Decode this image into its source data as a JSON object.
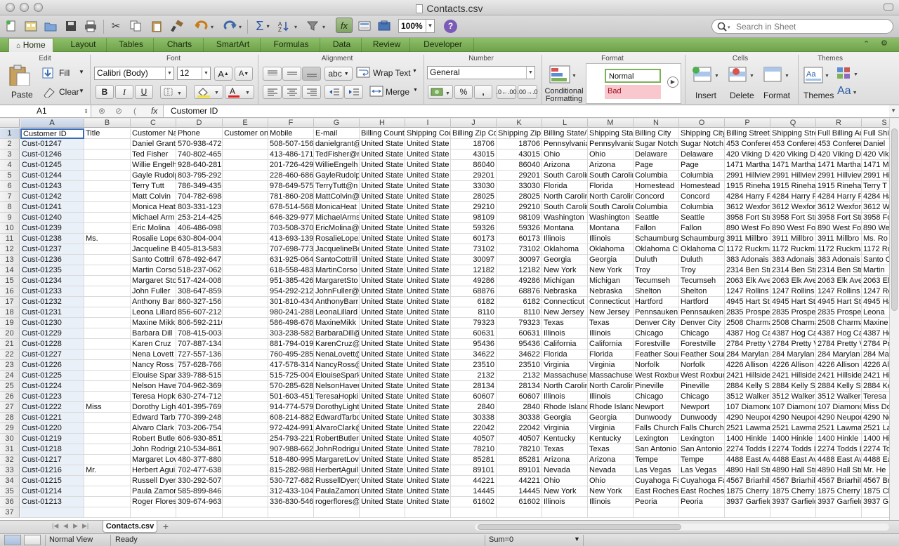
{
  "window": {
    "title": "Contacts.csv"
  },
  "toolbar": {
    "zoom": "100%",
    "help": "?",
    "search_placeholder": "Search in Sheet"
  },
  "ribbon": {
    "tabs": [
      "Home",
      "Layout",
      "Tables",
      "Charts",
      "SmartArt",
      "Formulas",
      "Data",
      "Review",
      "Developer"
    ],
    "active_tab": "Home",
    "groups": {
      "edit": "Edit",
      "font": "Font",
      "alignment": "Alignment",
      "number": "Number",
      "format": "Format",
      "cells": "Cells",
      "themes": "Themes"
    },
    "paste": "Paste",
    "fill": "Fill",
    "clear": "Clear",
    "font_name": "Calibri (Body)",
    "font_size": "12",
    "bold": "B",
    "italic": "I",
    "underline": "U",
    "abc": "abc",
    "wrap_text": "Wrap Text",
    "merge": "Merge",
    "number_format": "General",
    "percent": "%",
    "comma": ",",
    "dec_inc": ".0←.00",
    "dec_dec": ".00→.0",
    "conditional_formatting": "Conditional\nFormatting",
    "style_normal": "Normal",
    "style_bad": "Bad",
    "insert": "Insert",
    "delete": "Delete",
    "format_btn": "Format",
    "themes_btn": "Themes",
    "aa": "Aa"
  },
  "formula_bar": {
    "cell_ref": "A1",
    "fx": "fx",
    "content": "Customer ID"
  },
  "grid": {
    "columns": [
      "A",
      "B",
      "C",
      "D",
      "E",
      "F",
      "G",
      "H",
      "I",
      "J",
      "K",
      "L",
      "M",
      "N",
      "O",
      "P",
      "Q",
      "R",
      "S"
    ],
    "rows": [
      [
        "Customer ID",
        "Title",
        "Customer Na",
        "Phone",
        "Customer on",
        "Mobile",
        "E-mail",
        "Billing Count",
        "Shipping Cou",
        "Billing Zip Co",
        "Shipping Zip",
        "Billing State/",
        "Shipping Stat",
        "Billing City",
        "Shipping City",
        "Billing Street",
        "Shipping Stre",
        "Full Billing Ad",
        "Full Shi"
      ],
      [
        "Cust-01247",
        "",
        "Daniel Grant",
        "570-938-4729",
        "",
        "508-507-156",
        "danielgrant@",
        "United State",
        "United State",
        "18706",
        "18706",
        "Pennsylvania",
        "Pennsylvania",
        "Sugar Notch",
        "Sugar Notch",
        "453 Conferen",
        "453 Conferen",
        "453 Conferen",
        "Daniel"
      ],
      [
        "Cust-01246",
        "",
        "Ted Fisher",
        "740-802-4659",
        "",
        "413-486-171",
        "TedFisher@r",
        "United State",
        "United State",
        "43015",
        "43015",
        "Ohio",
        "Ohio",
        "Delaware",
        "Delaware",
        "420 Viking D",
        "420 Viking D",
        "420 Viking D",
        "420 Vik"
      ],
      [
        "Cust-01245",
        "",
        "Willie Engelh",
        "928-640-2818",
        "",
        "201-726-429",
        "WillieEngelh",
        "United State",
        "United State",
        "86040",
        "86040",
        "Arizona",
        "Arizona",
        "Page",
        "Page",
        "1471 Martha",
        "1471 Martha",
        "1471 Martha",
        "1471 M"
      ],
      [
        "Cust-01244",
        "",
        "Gayle Rudolp",
        "803-795-2925",
        "",
        "228-460-686",
        "GayleRudolp",
        "United State",
        "United State",
        "29201",
        "29201",
        "South Carolin",
        "South Carolin",
        "Columbia",
        "Columbia",
        "2991 Hillview",
        "2991 Hillview",
        "2991 Hillview",
        "2991 Hi"
      ],
      [
        "Cust-01243",
        "",
        "Terry Tutt",
        "786-349-4359",
        "",
        "978-649-575",
        "TerryTutt@n",
        "United State",
        "United State",
        "33030",
        "33030",
        "Florida",
        "Florida",
        "Homestead",
        "Homestead",
        "1915 Rinehar",
        "1915 Rinehar",
        "1915 Rinehar",
        "Terry T"
      ],
      [
        "Cust-01242",
        "",
        "Matt Colvin",
        "704-782-6984",
        "",
        "781-860-208",
        "MattColvin@",
        "United State",
        "United State",
        "28025",
        "28025",
        "North Carolin",
        "North Carolin",
        "Concord",
        "Concord",
        "4284 Harry P",
        "4284 Harry P",
        "4284 Harry P",
        "4284 Ha"
      ],
      [
        "Cust-01241",
        "",
        "Monica Heat",
        "803-331-1239",
        "",
        "678-514-568",
        "MonicaHeat",
        "United State",
        "United State",
        "29210",
        "29210",
        "South Carolin",
        "South Carolin",
        "Columbia",
        "Columbia",
        "3612 Wexfor",
        "3612 Wexfor",
        "3612 Wexfor",
        "3612 W"
      ],
      [
        "Cust-01240",
        "",
        "Michael Arm",
        "253-214-4254",
        "",
        "646-329-977",
        "MichaelArms",
        "United State",
        "United State",
        "98109",
        "98109",
        "Washington",
        "Washington",
        "Seattle",
        "Seattle",
        "3958 Fort Str",
        "3958 Fort Str",
        "3958 Fort Str",
        "3958 Fo"
      ],
      [
        "Cust-01239",
        "",
        "Eric Molina",
        "406-486-0983",
        "",
        "703-508-370",
        "EricMolina@",
        "United State",
        "United State",
        "59326",
        "59326",
        "Montana",
        "Montana",
        "Fallon",
        "Fallon",
        "890 West Fo",
        "890 West Fo",
        "890 West Fo",
        "890 We"
      ],
      [
        "Cust-01238",
        "Ms.",
        "Rosalie Lope",
        "630-804-0049",
        "",
        "413-693-139",
        "RosalieLopez",
        "United State",
        "United State",
        "60173",
        "60173",
        "Illinois",
        "Illinois",
        "Schaumburg",
        "Schaumburg",
        "3911 Millbro",
        "3911 Millbro",
        "3911 Millbro",
        "Ms. Ro"
      ],
      [
        "Cust-01237",
        "",
        "Jacqueline B",
        "405-813-5832",
        "",
        "707-698-773",
        "JacquelineBe",
        "United State",
        "United State",
        "73102",
        "73102",
        "Oklahoma",
        "Oklahoma",
        "Oklahoma Ci",
        "Oklahoma Ci",
        "1172 Ruckma",
        "1172 Ruckma",
        "1172 Ruckma",
        "1172 Ru"
      ],
      [
        "Cust-01236",
        "",
        "Santo Cottril",
        "678-492-6475",
        "",
        "631-925-064",
        "SantoCottrill",
        "United State",
        "United State",
        "30097",
        "30097",
        "Georgia",
        "Georgia",
        "Duluth",
        "Duluth",
        "383 Adonais",
        "383 Adonais",
        "383 Adonais",
        "Santo C"
      ],
      [
        "Cust-01235",
        "",
        "Martin Corso",
        "518-237-0620",
        "",
        "618-558-483",
        "MartinCorso",
        "United State",
        "United State",
        "12182",
        "12182",
        "New York",
        "New York",
        "Troy",
        "Troy",
        "2314 Ben Str",
        "2314 Ben Str",
        "2314 Ben Str",
        "Martin"
      ],
      [
        "Cust-01234",
        "",
        "Margaret Sto",
        "517-424-0081",
        "",
        "951-385-426",
        "MargaretSto",
        "United State",
        "United State",
        "49286",
        "49286",
        "Michigan",
        "Michigan",
        "Tecumseh",
        "Tecumseh",
        "2063 Elk Ave",
        "2063 Elk Ave",
        "2063 Elk Ave",
        "2063 El"
      ],
      [
        "Cust-01233",
        "",
        "John Fuller",
        "308-647-8594",
        "",
        "954-292-212",
        "JohnFuller@",
        "United State",
        "United State",
        "68876",
        "68876",
        "Nebraska",
        "Nebraska",
        "Shelton",
        "Shelton",
        "1247 Rollins",
        "1247 Rollins",
        "1247 Rollins",
        "1247 Ro"
      ],
      [
        "Cust-01232",
        "",
        "Anthony Bar",
        "860-327-1562",
        "",
        "301-810-434",
        "AnthonyBarr",
        "United State",
        "United State",
        "6182",
        "6182",
        "Connecticut",
        "Connecticut",
        "Hartford",
        "Hartford",
        "4945 Hart St",
        "4945 Hart St",
        "4945 Hart St",
        "4945 Ha"
      ],
      [
        "Cust-01231",
        "",
        "Leona Lillard",
        "856-607-2120",
        "",
        "980-241-288",
        "LeonaLillard",
        "United State",
        "United State",
        "8110",
        "8110",
        "New Jersey",
        "New Jersey",
        "Pennsauken",
        "Pennsauken",
        "2835 Prospe",
        "2835 Prospe",
        "2835 Prospe",
        "Leona"
      ],
      [
        "Cust-01230",
        "",
        "Maxine Mikk",
        "806-592-2110",
        "",
        "586-498-676",
        "MaxineMikk",
        "United State",
        "United State",
        "79323",
        "79323",
        "Texas",
        "Texas",
        "Denver City",
        "Denver City",
        "2508 Charma",
        "2508 Charma",
        "2508 Charma",
        "Maxine"
      ],
      [
        "Cust-01229",
        "",
        "Barbara Dill",
        "708-415-0034",
        "",
        "303-238-582",
        "BarbaraDill@",
        "United State",
        "United State",
        "60631",
        "60631",
        "Illinois",
        "Illinois",
        "Chicago",
        "Chicago",
        "4387 Hog Ca",
        "4387 Hog Ca",
        "4387 Hog Ca",
        "4387 Ho"
      ],
      [
        "Cust-01228",
        "",
        "Karen Cruz",
        "707-887-1349",
        "",
        "881-794-019",
        "KarenCruz@",
        "United State",
        "United State",
        "95436",
        "95436",
        "California",
        "California",
        "Forestville",
        "Forestville",
        "2784 Pretty V",
        "2784 Pretty V",
        "2784 Pretty V",
        "2784 Pr"
      ],
      [
        "Cust-01227",
        "",
        "Nena Lovett",
        "727-557-1365",
        "",
        "760-495-285",
        "NenaLovett@",
        "United State",
        "United State",
        "34622",
        "34622",
        "Florida",
        "Florida",
        "Feather Sour",
        "Feather Sour",
        "284 Marylan",
        "284 Marylan",
        "284 Marylan",
        "284 Ma"
      ],
      [
        "Cust-01226",
        "",
        "Nancy Ross",
        "757-628-7666",
        "",
        "417-578-314",
        "NancyRoss@",
        "United State",
        "United State",
        "23510",
        "23510",
        "Virginia",
        "Virginia",
        "Norfolk",
        "Norfolk",
        "4226 Allison",
        "4226 Allison",
        "4226 Allison",
        "4226 Al"
      ],
      [
        "Cust-01225",
        "",
        "Elouise Spark",
        "339-788-5157",
        "",
        "515-725-004",
        "ElouiseSpark",
        "United State",
        "United State",
        "2132",
        "2132",
        "Massachuset",
        "Massachuset",
        "West Roxbur",
        "West Roxbur",
        "2421 Hillside",
        "2421 Hillside",
        "2421 Hillside",
        "2421 Hi"
      ],
      [
        "Cust-01224",
        "",
        "Nelson Have",
        "704-962-3690",
        "",
        "570-285-628",
        "NelsonHaver",
        "United State",
        "United State",
        "28134",
        "28134",
        "North Carolin",
        "North Carolin",
        "Pineville",
        "Pineville",
        "2884 Kelly St",
        "2884 Kelly St",
        "2884 Kelly St",
        "2884 Ke"
      ],
      [
        "Cust-01223",
        "",
        "Teresa Hopki",
        "630-274-7120",
        "",
        "501-603-451",
        "TeresaHopki",
        "United State",
        "United State",
        "60607",
        "60607",
        "Illinois",
        "Illinois",
        "Chicago",
        "Chicago",
        "3512 Walker",
        "3512 Walker",
        "3512 Walker",
        "Teresa"
      ],
      [
        "Cust-01222",
        "Miss",
        "Dorothy Ligh",
        "401-395-7696",
        "",
        "914-774-579",
        "DorothyLight",
        "United State",
        "United State",
        "2840",
        "2840",
        "Rhode Island",
        "Rhode Island",
        "Newport",
        "Newport",
        "107 Diamonc",
        "107 Diamonc",
        "107 Diamonc",
        "Miss Do"
      ],
      [
        "Cust-01221",
        "",
        "Edward Tarb",
        "770-399-2486",
        "",
        "608-214-882",
        "EdwardTarbo",
        "United State",
        "United State",
        "30338",
        "30338",
        "Georgia",
        "Georgia",
        "Dunwoody",
        "Dunwoody",
        "4290 Neupor",
        "4290 Neupor",
        "4290 Neupor",
        "4290 Ne"
      ],
      [
        "Cust-01220",
        "",
        "Alvaro Clark",
        "703-206-7541",
        "",
        "972-424-991",
        "AlvaroClark@",
        "United State",
        "United State",
        "22042",
        "22042",
        "Virginia",
        "Virginia",
        "Falls Church",
        "Falls Church",
        "2521 Lawma",
        "2521 Lawma",
        "2521 Lawma",
        "2521 La"
      ],
      [
        "Cust-01219",
        "",
        "Robert Butle",
        "606-930-8511",
        "",
        "254-793-221",
        "RobertButler",
        "United State",
        "United State",
        "40507",
        "40507",
        "Kentucky",
        "Kentucky",
        "Lexington",
        "Lexington",
        "1400 Hinkle",
        "1400 Hinkle",
        "1400 Hinkle",
        "1400 Hi"
      ],
      [
        "Cust-01218",
        "",
        "John Rodrigu",
        "210-534-8615",
        "",
        "907-988-662",
        "JohnRodrigu",
        "United State",
        "United State",
        "78210",
        "78210",
        "Texas",
        "Texas",
        "San Antonio",
        "San Antonio",
        "2274 Todds L",
        "2274 Todds L",
        "2274 Todds L",
        "2274 To"
      ],
      [
        "Cust-01217",
        "",
        "Margaret Lov",
        "480-377-8803",
        "",
        "518-480-995",
        "MargaretLov",
        "United State",
        "United State",
        "85281",
        "85281",
        "Arizona",
        "Arizona",
        "Tempe",
        "Tempe",
        "4488 East Av",
        "4488 East Av",
        "4488 East Av",
        "4488 Ea"
      ],
      [
        "Cust-01216",
        "Mr.",
        "Herbert Agui",
        "702-477-6382",
        "",
        "815-282-988",
        "HerbertAguil",
        "United State",
        "United State",
        "89101",
        "89101",
        "Nevada",
        "Nevada",
        "Las Vegas",
        "Las Vegas",
        "4890 Hall Str",
        "4890 Hall Str",
        "4890 Hall Str",
        "Mr. He"
      ],
      [
        "Cust-01215",
        "",
        "Russell Dyer",
        "330-292-5078",
        "",
        "530-727-682",
        "RussellDyer@",
        "United State",
        "United State",
        "44221",
        "44221",
        "Ohio",
        "Ohio",
        "Cuyahoga Fa",
        "Cuyahoga Fa",
        "4567 Briarhil",
        "4567 Briarhil",
        "4567 Briarhil",
        "4567 Br"
      ],
      [
        "Cust-01214",
        "",
        "Paula Zamor",
        "585-899-8461",
        "",
        "312-433-104",
        "PaulaZamora",
        "United State",
        "United State",
        "14445",
        "14445",
        "New York",
        "New York",
        "East Rochest",
        "East Rochest",
        "1875 Cherry",
        "1875 Cherry",
        "1875 Cherry",
        "1875 Ch"
      ],
      [
        "Cust-01213",
        "",
        "Roger Flores",
        "309-674-9632",
        "",
        "336-830-546",
        "rogerflores@",
        "United State",
        "United State",
        "61602",
        "61602",
        "Illinois",
        "Illinois",
        "Peoria",
        "Peoria",
        "3937 Garfield",
        "3937 Garfield",
        "3937 Garfield",
        "3937 Ga"
      ],
      [
        "",
        "",
        "",
        "",
        "",
        "",
        "",
        "",
        "",
        "",
        "",
        "",
        "",
        "",
        "",
        "",
        "",
        "",
        ""
      ]
    ]
  },
  "sheets": {
    "active": "Contacts.csv",
    "add": "+"
  },
  "status": {
    "view": "Normal View",
    "ready": "Ready",
    "sum": "Sum=0"
  }
}
